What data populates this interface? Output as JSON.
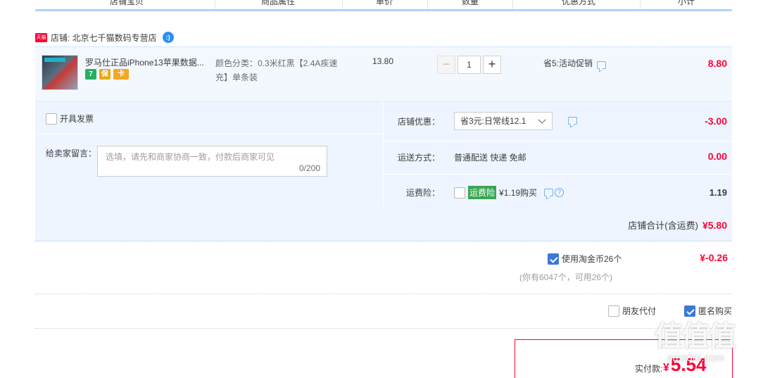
{
  "header": {
    "columns": [
      "店铺宝贝",
      "商品属性",
      "单价",
      "数量",
      "优惠方式",
      "小计"
    ]
  },
  "shop": {
    "badge": "天猫",
    "label": "店铺: 北京七千猫数码专营店",
    "wangwang_icon": "wangwang-chat-icon"
  },
  "item": {
    "title": "罗马仕正品iPhone13苹果数据...",
    "attr_line1": "颜色分类：0.3米红黑【2.4A疾速",
    "attr_line2": "充】单条装",
    "price": "13.80",
    "quantity": "1",
    "qty_minus": "−",
    "qty_plus": "+",
    "discount": "省5:活动促销",
    "subtotal": "8.80",
    "service_icons": [
      "7",
      "保",
      "卡"
    ]
  },
  "extras": {
    "invoice_label": "开具发票",
    "message_label": "给卖家留言：",
    "message_placeholder": "选填，请先和商家协商一致，付款后商家可见",
    "message_count": "0/200",
    "shop_discount_label": "店铺优惠：",
    "shop_discount_value": "省3元:日常线12.1",
    "shop_discount_amount": "-3.00",
    "shipping_label": "运送方式：",
    "shipping_value": "普通配送 快递 免邮",
    "shipping_amount": "0.00",
    "insurance_label": "运费险：",
    "insurance_tag": "运费险",
    "insurance_price": "¥1.19购买",
    "insurance_amount": "1.19"
  },
  "shop_total": {
    "label": "店铺合计(含运费)",
    "amount": "¥5.80"
  },
  "coins": {
    "label": "使用淘金币26个",
    "sub": "(你有6047个，可用26个)",
    "amount": "¥-0.26",
    "checked": true
  },
  "options": {
    "friend_pay": "朋友代付",
    "anonymous": "匿名购买",
    "anonymous_checked": true
  },
  "payment": {
    "label": "实付款:",
    "currency": "¥",
    "amount": "5.54"
  },
  "watermark": {
    "logo": "值值值",
    "url": "smzdm.com"
  }
}
